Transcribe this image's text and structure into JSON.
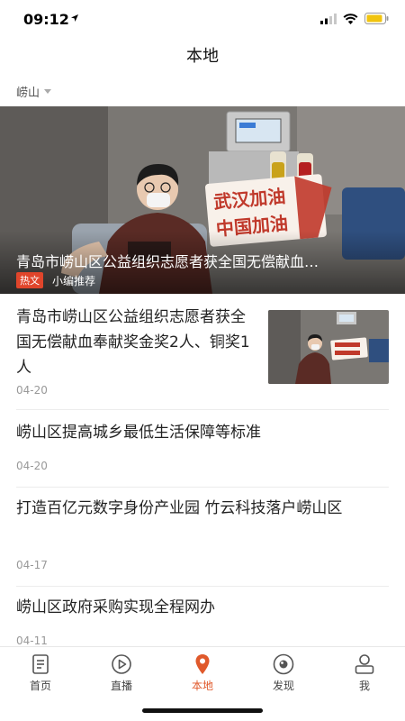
{
  "status_bar": {
    "time": "09:12"
  },
  "header": {
    "title": "本地"
  },
  "region": {
    "label": "崂山"
  },
  "hero": {
    "title": "青岛市崂山区公益组织志愿者获全国无偿献血…",
    "tag_hot": "热文",
    "tag_editor": "小编推荐",
    "sign_line1": "武汉加油",
    "sign_line2": "中国加油"
  },
  "news": [
    {
      "title": "青岛市崂山区公益组织志愿者获全国无偿献血奉献奖金奖2人、铜奖1人",
      "date": "04-20"
    },
    {
      "title": "崂山区提高城乡最低生活保障等标准",
      "date": "04-20"
    },
    {
      "title": "打造百亿元数字身份产业园  竹云科技落户崂山区",
      "date": "04-17"
    },
    {
      "title": "崂山区政府采购实现全程网办",
      "date": "04-11"
    }
  ],
  "tabs": [
    {
      "label": "首页"
    },
    {
      "label": "直播"
    },
    {
      "label": "本地"
    },
    {
      "label": "发现"
    },
    {
      "label": "我"
    }
  ],
  "colors": {
    "accent": "#e0592b",
    "hot_tag": "#e0452b"
  }
}
